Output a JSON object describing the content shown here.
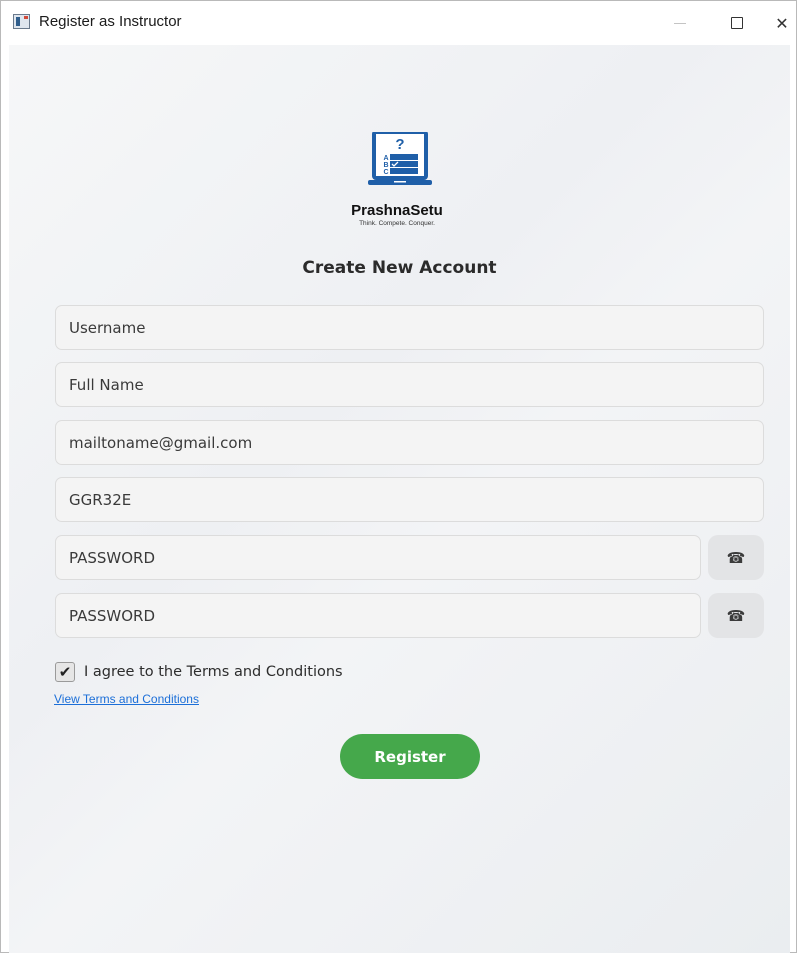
{
  "window": {
    "title": "Register as Instructor",
    "min_glyph": "—",
    "close_glyph": "✕"
  },
  "logo": {
    "question_mark": "?",
    "option_a": "A",
    "option_b": "B",
    "option_c": "C",
    "name": "PrashnaSetu",
    "tagline": "Think. Compete. Conquer."
  },
  "form": {
    "heading": "Create New Account",
    "username": "Username",
    "full_name": "Full Name",
    "email": "mailtoname@gmail.com",
    "code": "GGR32E",
    "password": "PASSWORD",
    "confirm_password": "PASSWORD",
    "eye_icon_glyph": "☎",
    "checkbox_glyph": "✔",
    "agree_label": "I agree to the Terms and Conditions",
    "agree_checked": true,
    "terms_link": "View Terms and Conditions",
    "register_label": "Register"
  },
  "colors": {
    "accent_green": "#45a84b",
    "link_blue": "#1c6fd8",
    "logo_blue": "#1f5fa8"
  }
}
